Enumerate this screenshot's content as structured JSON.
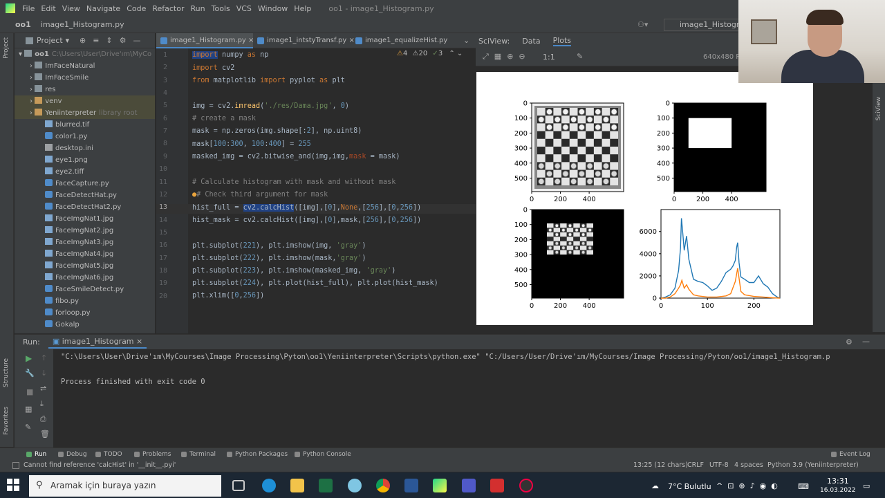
{
  "menu": {
    "items": [
      "File",
      "Edit",
      "View",
      "Navigate",
      "Code",
      "Refactor",
      "Run",
      "Tools",
      "VCS",
      "Window",
      "Help"
    ],
    "window_title": "oo1 - image1_Histogram.py"
  },
  "navbar": {
    "project": "oo1",
    "file": "image1_Histogram.py",
    "run_config": "image1_Histogram"
  },
  "project_panel": {
    "title": "Project",
    "root": "oo1",
    "root_path": "C:\\Users\\User\\Drive'ım\\MyCo",
    "items": [
      {
        "label": "ImFaceNatural",
        "type": "folder",
        "depth": 1
      },
      {
        "label": "ImFaceSmile",
        "type": "folder",
        "depth": 1
      },
      {
        "label": "res",
        "type": "folder",
        "depth": 1
      },
      {
        "label": "venv",
        "type": "folder-excluded",
        "depth": 1
      },
      {
        "label": "Yeniinterpreter",
        "type": "folder-excluded",
        "depth": 1,
        "note": "library root"
      },
      {
        "label": "blurred.tif",
        "type": "img",
        "depth": 1
      },
      {
        "label": "color1.py",
        "type": "py",
        "depth": 1
      },
      {
        "label": "desktop.ini",
        "type": "file",
        "depth": 1
      },
      {
        "label": "eye1.png",
        "type": "img",
        "depth": 1
      },
      {
        "label": "eye2.tiff",
        "type": "img",
        "depth": 1
      },
      {
        "label": "FaceCapture.py",
        "type": "py",
        "depth": 1
      },
      {
        "label": "FaceDetectHat.py",
        "type": "py",
        "depth": 1
      },
      {
        "label": "FaceDetectHat2.py",
        "type": "py",
        "depth": 1
      },
      {
        "label": "FaceImgNat1.jpg",
        "type": "img",
        "depth": 1
      },
      {
        "label": "FaceImgNat2.jpg",
        "type": "img",
        "depth": 1
      },
      {
        "label": "FaceImgNat3.jpg",
        "type": "img",
        "depth": 1
      },
      {
        "label": "FaceImgNat4.jpg",
        "type": "img",
        "depth": 1
      },
      {
        "label": "FaceImgNat5.jpg",
        "type": "img",
        "depth": 1
      },
      {
        "label": "FaceImgNat6.jpg",
        "type": "img",
        "depth": 1
      },
      {
        "label": "FaceSmileDetect.py",
        "type": "py",
        "depth": 1
      },
      {
        "label": "fibo.py",
        "type": "py",
        "depth": 1
      },
      {
        "label": "forloop.py",
        "type": "py",
        "depth": 1
      },
      {
        "label": "Gokalp",
        "type": "py",
        "depth": 1
      }
    ]
  },
  "tabs": [
    "image1_Histogram.py",
    "image1_intstyTransf.py",
    "image1_equalizeHist.py"
  ],
  "inspections": {
    "warnings": "4",
    "weak": "20",
    "typos": "3"
  },
  "code": {
    "l1_a": "import",
    "l1_b": " numpy ",
    "l1_c": "as",
    "l1_d": " np",
    "l2_a": "import",
    "l2_b": " cv2",
    "l3_a": "from",
    "l3_b": " matplotlib ",
    "l3_c": "import",
    "l3_d": " pyplot ",
    "l3_e": "as",
    "l3_f": " plt",
    "l5_a": "img = ",
    "l5_b": "cv2.",
    "l5_c": "imread",
    "l5_d": "(",
    "l5_e": "'./res/Dama.jpg'",
    "l5_f": ", ",
    "l5_g": "0",
    "l5_h": ")",
    "l6": "# create a mask",
    "l7_a": "mask = np.zeros(img.shape[:",
    "l7_b": "2",
    "l7_c": "], np.uint8)",
    "l8_a": "mask[",
    "l8_b": "100",
    "l8_c": ":",
    "l8_d": "300",
    "l8_e": ", ",
    "l8_f": "100",
    "l8_g": ":",
    "l8_h": "400",
    "l8_i": "] = ",
    "l8_j": "255",
    "l9_a": "masked_img = ",
    "l9_b": "cv2.bitwise_and",
    "l9_c": "(img,img,",
    "l9_d": "mask",
    "l9_e": " = mask)",
    "l11": "# Calculate histogram with mask and without mask",
    "l12": "# Check third argument for mask",
    "l13_a": "hist_full = ",
    "l13_b": "cv2.calcHist",
    "l13_c": "([img],[",
    "l13_d": "0",
    "l13_e": "],",
    "l13_f": "None",
    "l13_g": ",[",
    "l13_h": "256",
    "l13_i": "],[",
    "l13_j": "0",
    "l13_k": ",",
    "l13_l": "256",
    "l13_m": "])",
    "l14_a": "hist_mask = ",
    "l14_b": "cv2.calcHist",
    "l14_c": "([img],[",
    "l14_d": "0",
    "l14_e": "],mask,[",
    "l14_f": "256",
    "l14_g": "],[",
    "l14_h": "0",
    "l14_i": ",",
    "l14_j": "256",
    "l14_k": "])",
    "l16_a": "plt.subplot(",
    "l16_b": "221",
    "l16_c": "), plt.imshow(img, ",
    "l16_d": "'gray'",
    "l16_e": ")",
    "l17_a": "plt.subplot(",
    "l17_b": "222",
    "l17_c": "), plt.imshow(mask,",
    "l17_d": "'gray'",
    "l17_e": ")",
    "l18_a": "plt.subplot(",
    "l18_b": "223",
    "l18_c": "), plt.imshow(masked_img, ",
    "l18_d": "'gray'",
    "l18_e": ")",
    "l19_a": "plt.subplot(",
    "l19_b": "224",
    "l19_c": "), plt.plot(hist_full), plt.plot(hist_mask)",
    "l20_a": "plt.xlim([",
    "l20_b": "0",
    "l20_c": ",",
    "l20_d": "256",
    "l20_e": "])"
  },
  "sciview": {
    "title": "SciView:",
    "tab_data": "Data",
    "tab_plots": "Plots",
    "size": "640x480 PN",
    "ratio": "1:1"
  },
  "plots": {
    "img_ticks_y": [
      "0",
      "100",
      "200",
      "300",
      "400",
      "500"
    ],
    "img_ticks_x": [
      "0",
      "200",
      "400"
    ],
    "hist_ticks_y": [
      "0",
      "2000",
      "4000",
      "6000"
    ],
    "hist_ticks_x": [
      "0",
      "100",
      "200"
    ]
  },
  "chart_data": {
    "type": "line",
    "xlim": [
      0,
      256
    ],
    "ylim": [
      0,
      7500
    ],
    "series": [
      {
        "x": [
          0,
          10,
          20,
          30,
          38,
          42,
          44,
          47,
          50,
          55,
          60,
          70,
          80,
          90,
          100,
          110,
          120,
          130,
          140,
          150,
          155,
          160,
          163,
          165,
          168,
          172,
          180,
          190,
          200,
          210,
          220,
          230,
          240,
          250,
          256
        ],
        "y": [
          0,
          100,
          300,
          900,
          2500,
          4500,
          7200,
          5800,
          4300,
          5600,
          3500,
          1700,
          1500,
          1400,
          1100,
          700,
          900,
          1500,
          2300,
          2600,
          2900,
          3400,
          4600,
          5000,
          3200,
          1900,
          1700,
          1400,
          1400,
          2000,
          1300,
          1000,
          400,
          100,
          0
        ],
        "color": "#1f77b4"
      },
      {
        "x": [
          0,
          10,
          20,
          30,
          38,
          42,
          45,
          50,
          55,
          60,
          70,
          80,
          100,
          120,
          140,
          150,
          160,
          165,
          168,
          172,
          180,
          200,
          220,
          240,
          256
        ],
        "y": [
          0,
          0,
          100,
          400,
          900,
          1200,
          1600,
          900,
          1200,
          800,
          300,
          200,
          100,
          100,
          200,
          400,
          1500,
          2700,
          1800,
          600,
          300,
          150,
          100,
          30,
          0
        ],
        "color": "#ff7f0e"
      }
    ]
  },
  "run": {
    "label": "Run:",
    "config": "image1_Histogram",
    "cmd": "\"C:\\Users\\User\\Drive'ım\\MyCourses\\Image Processing\\Pyton\\oo1\\Yeniinterpreter\\Scripts\\python.exe\" \"C:/Users/User/Drive'ım/MyCourses/Image Processing/Pyton/oo1/image1_Histogram.p",
    "exit": "Process finished with exit code 0"
  },
  "tooltabs": [
    "Run",
    "Debug",
    "TODO",
    "Problems",
    "Terminal",
    "Python Packages",
    "Python Console",
    "Event Log"
  ],
  "status": {
    "message": "Cannot find reference 'calcHist' in '__init__.pyi'",
    "position": "13:25 (12 chars)",
    "eol": "CRLF",
    "enc": "UTF-8",
    "indent": "4 spaces",
    "interp": "Python 3.9 (Yeniinterpreter)"
  },
  "taskbar": {
    "search_placeholder": "Aramak için buraya yazın",
    "weather": "7°C  Bulutlu",
    "time": "13:31",
    "date": "16.03.2022"
  }
}
